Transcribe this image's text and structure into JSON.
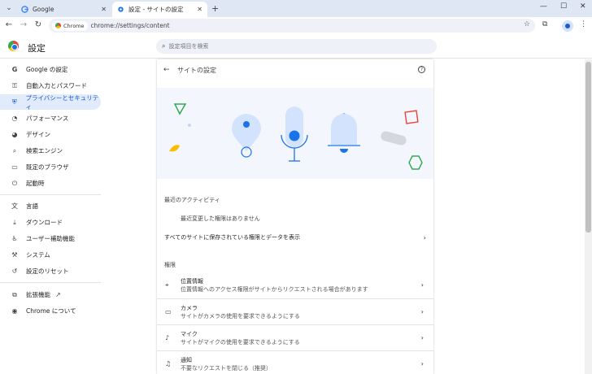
{
  "tabs": [
    {
      "title": "Google",
      "active": false
    },
    {
      "title": "設定 - サイトの設定",
      "active": true
    }
  ],
  "toolbar": {
    "chip_label": "Chrome",
    "url": "chrome://settings/content"
  },
  "header": {
    "title": "設定",
    "search_placeholder": "設定項目を検索"
  },
  "sidebar": {
    "items": [
      {
        "label": "Google の設定",
        "icon": "google-g-icon",
        "active": false
      },
      {
        "label": "自動入力とパスワード",
        "icon": "key-icon",
        "active": false
      },
      {
        "label": "プライバシーとセキュリティ",
        "icon": "shield-icon",
        "active": true
      },
      {
        "label": "パフォーマンス",
        "icon": "speedometer-icon",
        "active": false
      },
      {
        "label": "デザイン",
        "icon": "palette-icon",
        "active": false
      },
      {
        "label": "検索エンジン",
        "icon": "search-icon",
        "active": false
      },
      {
        "label": "既定のブラウザ",
        "icon": "browser-window-icon",
        "active": false
      },
      {
        "label": "起動時",
        "icon": "power-icon",
        "active": false
      },
      {
        "label": "言語",
        "icon": "translate-icon",
        "active": false
      },
      {
        "label": "ダウンロード",
        "icon": "download-icon",
        "active": false
      },
      {
        "label": "ユーザー補助機能",
        "icon": "accessibility-icon",
        "active": false
      },
      {
        "label": "システム",
        "icon": "wrench-icon",
        "active": false
      },
      {
        "label": "設定のリセット",
        "icon": "reset-icon",
        "active": false
      },
      {
        "label": "拡張機能",
        "icon": "puzzle-icon",
        "active": false
      },
      {
        "label": "Chrome について",
        "icon": "chrome-icon",
        "active": false
      }
    ]
  },
  "main": {
    "subpage_title": "サイトの設定",
    "recent_activity_heading": "最近のアクティビティ",
    "no_recent_changes": "最近変更した権限はありません",
    "view_all_link": "すべてのサイトに保存されている権限とデータを表示",
    "permissions_heading": "権限",
    "permissions": [
      {
        "title": "位置情報",
        "description": "位置情報へのアクセス権限がサイトからリクエストされる場合があります",
        "icon": "location-pin-icon"
      },
      {
        "title": "カメラ",
        "description": "サイトがカメラの使用を要求できるようにする",
        "icon": "camera-icon"
      },
      {
        "title": "マイク",
        "description": "サイトがマイクの使用を要求できるようにする",
        "icon": "microphone-icon"
      },
      {
        "title": "通知",
        "description": "不要なリクエストを閉じる（推奨）",
        "icon": "bell-icon"
      }
    ]
  },
  "colors": {
    "accent": "#0b57d0",
    "active_bg": "#e2ebfc",
    "tabstrip_bg": "#dfe7f5"
  }
}
